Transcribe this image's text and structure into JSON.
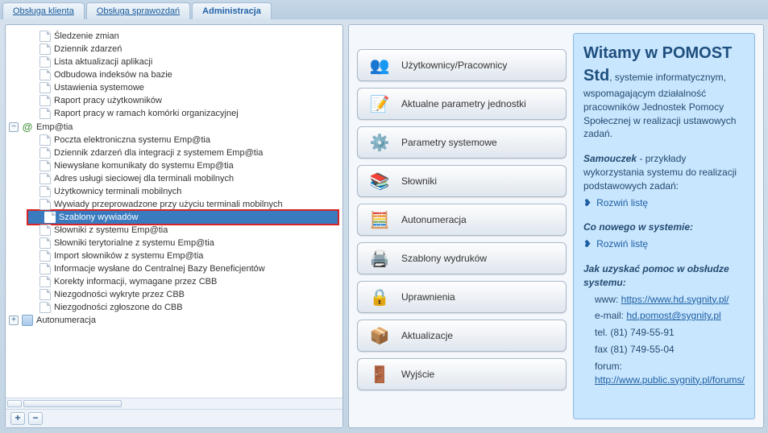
{
  "tabs": {
    "klienta": "Obsługa klienta",
    "sprawozdan": "Obsługa sprawozdań",
    "admin": "Administracja"
  },
  "tree": {
    "root_misc": [
      "Śledzenie zmian",
      "Dziennik zdarzeń",
      "Lista aktualizacji aplikacji",
      "Odbudowa indeksów na bazie",
      "Ustawienia systemowe",
      "Raport pracy użytkowników",
      "Raport pracy w ramach komórki organizacyjnej"
    ],
    "empatia_label": "Emp@tia",
    "empatia_items": [
      "Poczta elektroniczna systemu Emp@tia",
      "Dziennik zdarzeń dla integracji z systemem Emp@tia",
      "Niewysłane komunikaty do systemu Emp@tia",
      "Adres usługi sieciowej dla terminali mobilnych",
      "Użytkownicy terminali mobilnych",
      "Wywiady przeprowadzone przy użyciu terminali mobilnych",
      "Szablony wywiadów",
      "Słowniki z systemu Emp@tia",
      "Słowniki terytorialne z systemu Emp@tia",
      "Import słowników z systemu Emp@tia",
      "Informacje wysłane do Centralnej Bazy Beneficjentów",
      "Korekty informacji, wymagane przez CBB",
      "Niezgodności wykryte przez CBB",
      "Niezgodności zgłoszone do CBB"
    ],
    "selected_index": 6,
    "auton_label": "Autonumeracja"
  },
  "buttons": {
    "users": "Użytkownicy/Pracownicy",
    "params_unit": "Aktualne parametry jednostki",
    "params_sys": "Parametry systemowe",
    "dicts": "Słowniki",
    "auton": "Autonumeracja",
    "templates": "Szablony wydruków",
    "perm": "Uprawnienia",
    "updates": "Aktualizacje",
    "exit": "Wyjście"
  },
  "icons": {
    "users": "👥",
    "params_unit": "📝",
    "params_sys": "⚙️",
    "dicts": "📚",
    "auton": "🧮",
    "templates": "🖨️",
    "perm": "🔒",
    "updates": "📦",
    "exit": "🚪"
  },
  "welcome": {
    "title": "Witamy w POMOST Std",
    "body": ", systemie informatycznym, wspomagającym działalność pracowników Jednostek Pomocy Społecznej w realizacji ustawowych zadań.",
    "samouczek_title": "Samouczek",
    "samouczek_rest": " - przykłady wykorzystania systemu do realizacji podstawowych zadań:",
    "expand": "Rozwiń listę",
    "nowego": "Co nowego w systemie:",
    "pomoc": "Jak uzyskać pomoc w obsłudze systemu:",
    "www_url": "https://www.hd.sygnity.pl/",
    "email": "hd.pomost@sygnity.pl",
    "tel": "tel. (81) 749-55-91",
    "fax": "fax (81) 749-55-04",
    "forum_url": "http://www.public.sygnity.pl/forums/",
    "www_label": "www: ",
    "email_label": "e-mail: ",
    "forum_label": "forum: "
  }
}
